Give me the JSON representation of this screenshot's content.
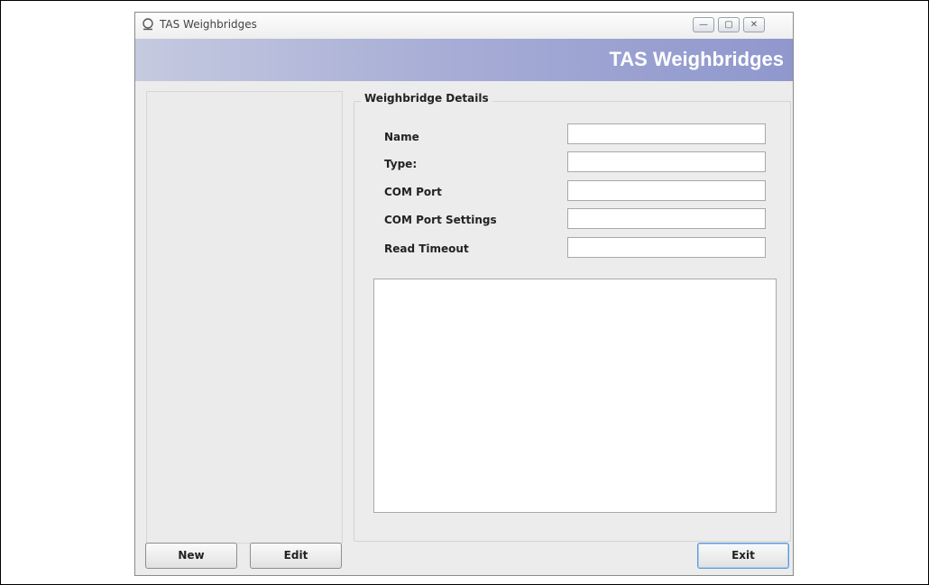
{
  "window": {
    "title": "TAS Weighbridges",
    "controls": {
      "minimize": "—",
      "maximize": "▢",
      "close": "✕"
    }
  },
  "banner": {
    "title": "TAS Weighbridges"
  },
  "details": {
    "group_title": "Weighbridge Details",
    "fields": [
      {
        "label": "Name",
        "value": ""
      },
      {
        "label": "Type:",
        "value": ""
      },
      {
        "label": "COM Port",
        "value": ""
      },
      {
        "label": "COM Port Settings",
        "value": ""
      },
      {
        "label": "Read Timeout",
        "value": ""
      }
    ],
    "notes_value": ""
  },
  "buttons": {
    "new": "New",
    "edit": "Edit",
    "exit": "Exit"
  },
  "colors": {
    "banner_start": "#c5cae0",
    "banner_end": "#8f97cd",
    "focus_border": "#5b9bd5"
  },
  "icons": {
    "app": "globe-icon"
  }
}
